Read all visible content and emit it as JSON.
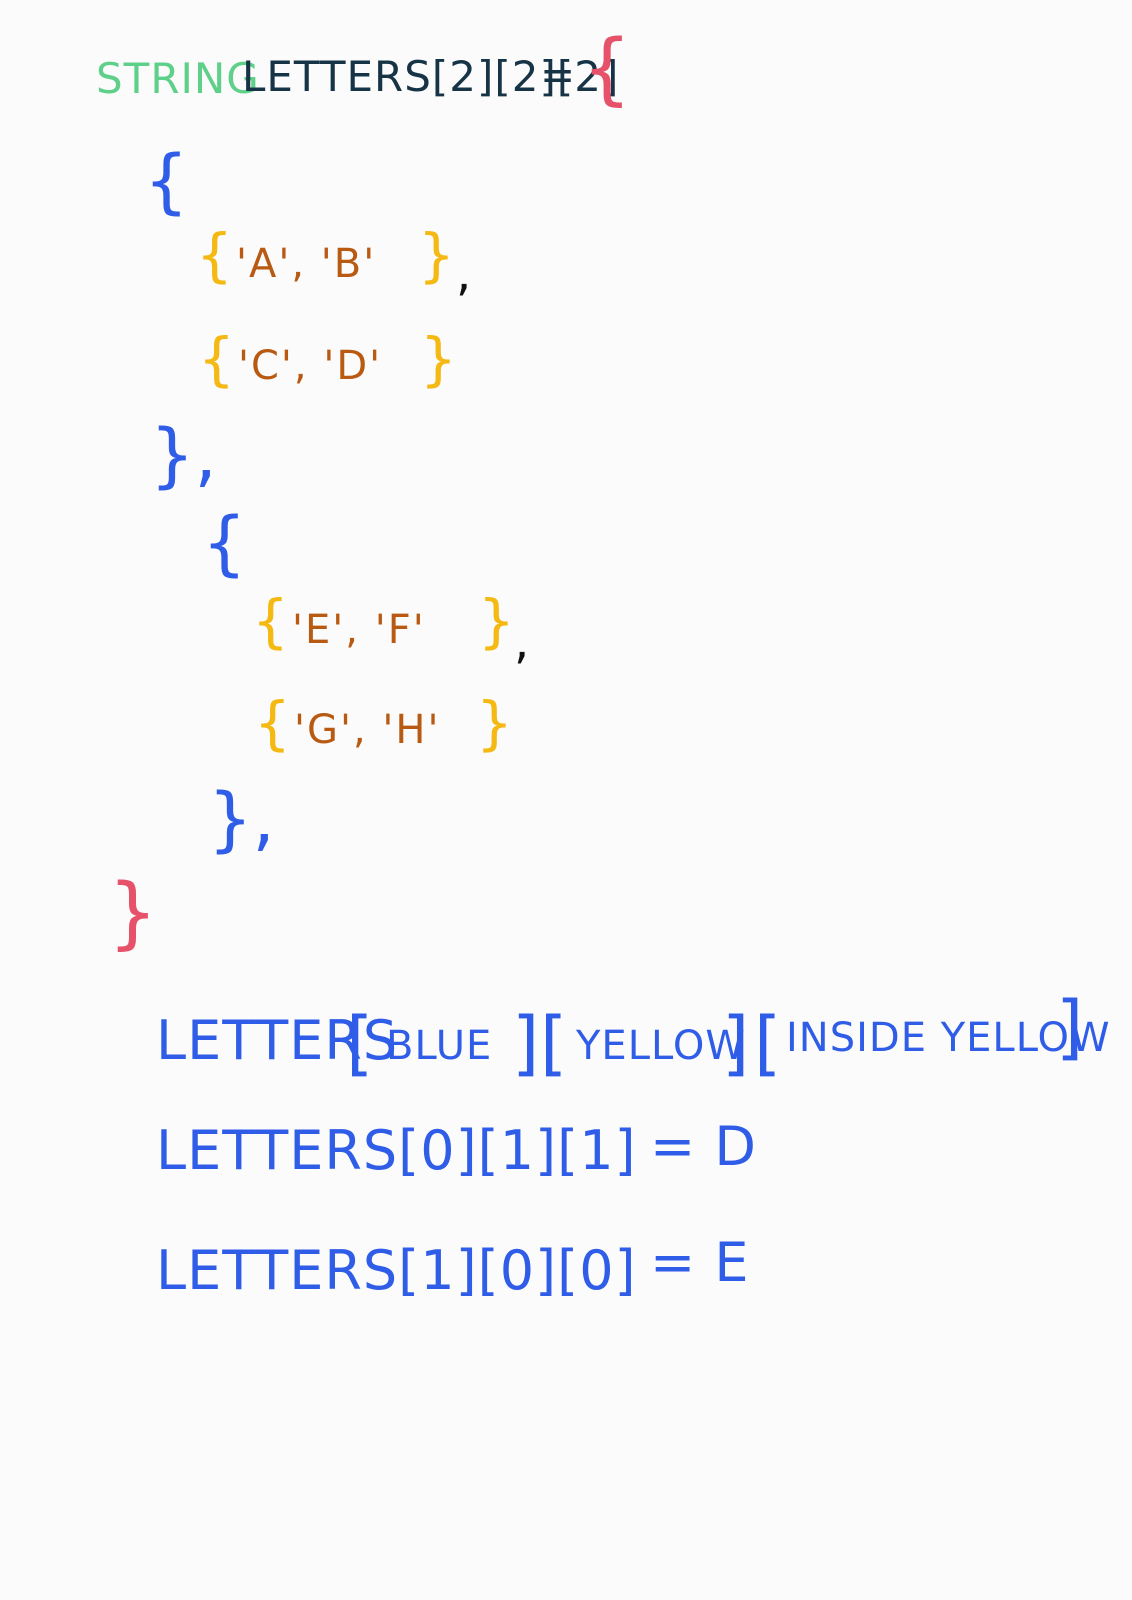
{
  "colors": {
    "keyword": "#5fd08a",
    "identifier": "#173446",
    "outer_brace": "#e5526a",
    "middle_brace": "#2f5de8",
    "inner_brace": "#f5b914",
    "element": "#b85a12",
    "comma": "#111111",
    "annotation": "#2f5de8"
  },
  "declaration": {
    "keyword": "STRING",
    "name": "LETTERS[2][2][2]",
    "assign": "=",
    "open_brace": "{"
  },
  "block1": {
    "open": "{",
    "row1": {
      "open": "{",
      "items": "'A', 'B'",
      "close": "}",
      "comma": ","
    },
    "row2": {
      "open": "{",
      "items": "'C', 'D'",
      "close": "}"
    },
    "close": "},"
  },
  "block2": {
    "open": "{",
    "row1": {
      "open": "{",
      "items": "'E', 'F'",
      "close": "}",
      "comma": ","
    },
    "row2": {
      "open": "{",
      "items": "'G', 'H'",
      "close": "}"
    },
    "close": "},"
  },
  "closing_brace": "}",
  "notes": {
    "legend": {
      "name": "LETTERS",
      "b1": "BLUE",
      "b2": "YELLOW",
      "b3": "INSIDE YELLOW"
    },
    "example1": {
      "text": "LETTERS[0][1][1]",
      "result": "= D"
    },
    "example2": {
      "text": "LETTERS[1][0][0]",
      "result": "= E"
    }
  }
}
